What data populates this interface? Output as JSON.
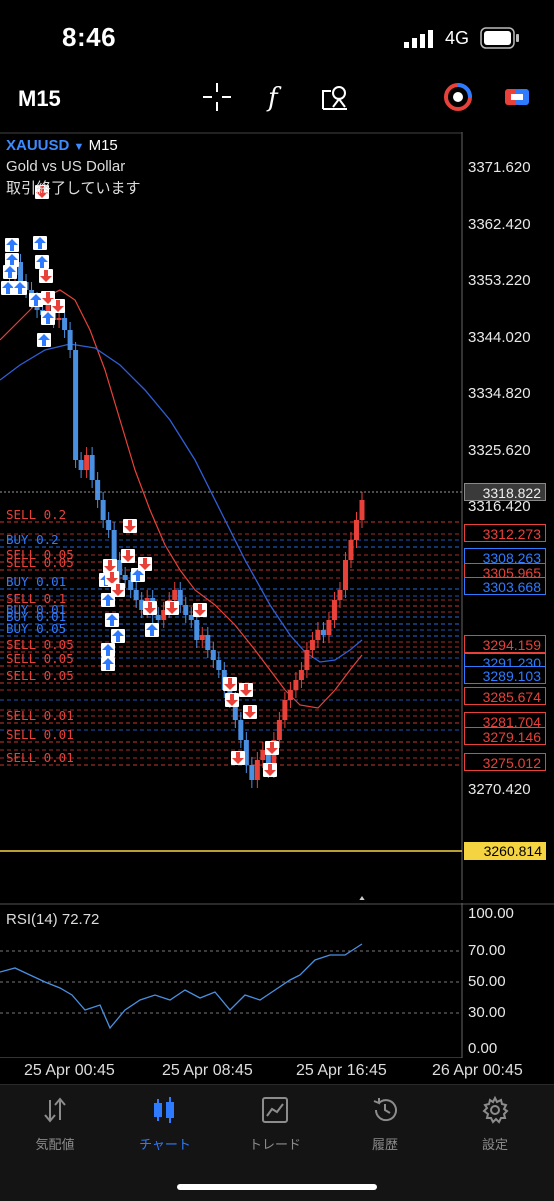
{
  "status_bar": {
    "time": "8:46",
    "network": "4G",
    "signal_icon": "signal-bars-icon",
    "battery_icon": "battery-icon"
  },
  "toolbar": {
    "timeframe": "M15",
    "icons": [
      "crosshair-icon",
      "indicator-f-icon",
      "objects-icon",
      "one-click-trading-icon",
      "account-switch-icon"
    ]
  },
  "symbol": {
    "name": "XAUUSD",
    "timeframe": "M15",
    "description": "Gold vs US Dollar",
    "status": "取引終了しています"
  },
  "price_axis": {
    "labels": [
      "3371.620",
      "3362.420",
      "3353.220",
      "3344.020",
      "3334.820",
      "3325.620",
      "3316.420",
      "3270.420"
    ],
    "current_price": "3318.822",
    "tags": [
      {
        "value": "3312.273",
        "type": "sell"
      },
      {
        "value": "3308.263",
        "type": "buy"
      },
      {
        "value": "3305.965",
        "type": "sell"
      },
      {
        "value": "3303.668",
        "type": "buy"
      },
      {
        "value": "3294.159",
        "type": "sell"
      },
      {
        "value": "3291.230",
        "type": "buy"
      },
      {
        "value": "3289.103",
        "type": "buy"
      },
      {
        "value": "3285.674",
        "type": "sell"
      },
      {
        "value": "3281.704",
        "type": "sell"
      },
      {
        "value": "3279.146",
        "type": "sell"
      },
      {
        "value": "3275.012",
        "type": "sell"
      }
    ],
    "alert_level": "3260.814"
  },
  "orders": [
    {
      "label": "SELL 0.2",
      "type": "sell"
    },
    {
      "label": "BUY 0.2",
      "type": "buy"
    },
    {
      "label": "SELL 0.05",
      "type": "sell"
    },
    {
      "label": "SELL 0.05",
      "type": "sell"
    },
    {
      "label": "BUY 0.01",
      "type": "buy"
    },
    {
      "label": "SELL 0.1",
      "type": "sell"
    },
    {
      "label": "BUY 0.01",
      "type": "buy"
    },
    {
      "label": "BUY 0.01",
      "type": "buy"
    },
    {
      "label": "BUY 0.05",
      "type": "buy"
    },
    {
      "label": "SELL 0.05",
      "type": "sell"
    },
    {
      "label": "SELL 0.05",
      "type": "sell"
    },
    {
      "label": "SELL 0.05",
      "type": "sell"
    },
    {
      "label": "SELL 0.01",
      "type": "sell"
    },
    {
      "label": "SELL 0.01",
      "type": "sell"
    },
    {
      "label": "SELL 0.01",
      "type": "sell"
    }
  ],
  "rsi": {
    "label": "RSI(14) 72.72",
    "levels": [
      "100.00",
      "70.00",
      "50.00",
      "30.00",
      "0.00"
    ]
  },
  "time_axis": [
    "25 Apr 00:45",
    "25 Apr 08:45",
    "25 Apr 16:45",
    "26 Apr 00:45"
  ],
  "colors": {
    "buy": "#2f7bff",
    "sell": "#e8413a",
    "ma_fast": "#e8413a",
    "ma_slow": "#2f5fd6",
    "alert": "#f5d442",
    "active_tab": "#2f7bff"
  },
  "bottom_nav": [
    {
      "label": "気配値",
      "icon": "quotes-arrows-icon",
      "active": false
    },
    {
      "label": "チャート",
      "icon": "candles-icon",
      "active": true
    },
    {
      "label": "トレード",
      "icon": "trade-chart-icon",
      "active": false
    },
    {
      "label": "履歴",
      "icon": "history-clock-icon",
      "active": false
    },
    {
      "label": "設定",
      "icon": "gear-icon",
      "active": false
    }
  ]
}
